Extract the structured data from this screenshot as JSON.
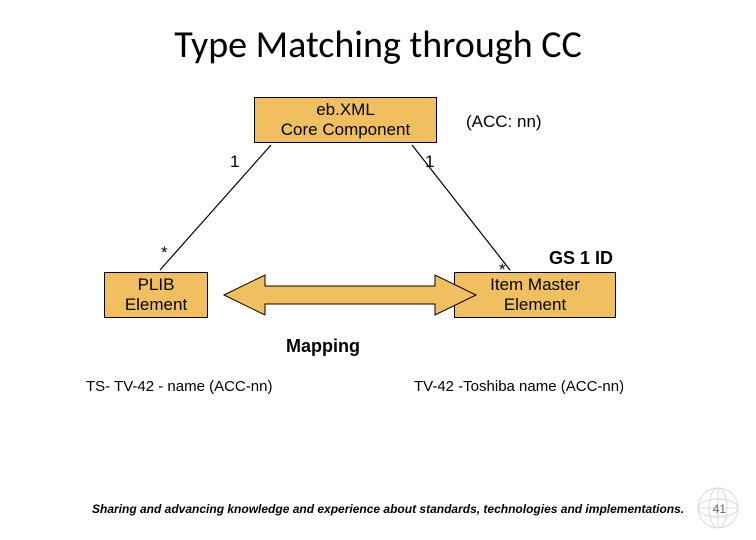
{
  "title": "Type Matching through CC",
  "boxes": {
    "top": "eb.XML\nCore Component",
    "left": "PLIB\nElement",
    "right": "Item Master\nElement"
  },
  "labels": {
    "acc": "(ACC: nn)",
    "top_one_left": "1",
    "top_one_right": "1",
    "star_left": "*",
    "star_right": "*",
    "gs1": "GS 1 ID",
    "mapping": "Mapping",
    "body_left": "TS- TV-42 - name (ACC-nn)",
    "body_right": "TV-42 -Toshiba name (ACC-nn)"
  },
  "footer": "Sharing and advancing knowledge and experience about standards, technologies and implementations.",
  "page": "41"
}
